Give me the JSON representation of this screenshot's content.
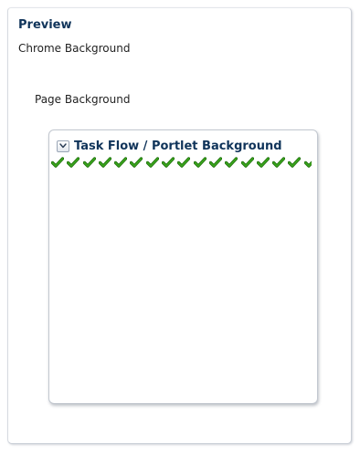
{
  "preview": {
    "title": "Preview",
    "chrome_label": "Chrome Background",
    "page_label": "Page Background",
    "taskflow": {
      "title": "Task Flow / Portlet Background",
      "disclose_icon": "chevron-down-icon",
      "status_icon": "green-checkmark-icon",
      "status_icon_count": 17
    }
  },
  "colors": {
    "title_text": "#10345a",
    "body_text": "#222222",
    "panel_border": "#c9ced6",
    "check_green": "#3aa51c",
    "check_dark": "#1f6e0e"
  }
}
